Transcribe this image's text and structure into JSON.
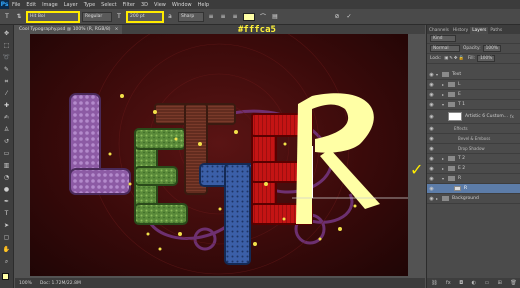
{
  "app": {
    "logo": "Ps"
  },
  "menu": [
    "File",
    "Edit",
    "Image",
    "Layer",
    "Type",
    "Select",
    "Filter",
    "3D",
    "View",
    "Window",
    "Help"
  ],
  "options": {
    "font_family": "Hit Bol",
    "font_style": "Regular",
    "font_size": "200 pt",
    "antialias": "Sharp",
    "text_color": "#ffffa5"
  },
  "annotation": "#fffca5",
  "document": {
    "tab_title": "Cool Typography.psd @ 100% (R, RGB/8)",
    "status_zoom": "100%",
    "status_doc": "Doc: 1.72M/22.8M"
  },
  "artwork": {
    "letters": [
      "L",
      "E",
      "T",
      "T",
      "E",
      "R"
    ],
    "accent_color": "#ffffa5"
  },
  "panel": {
    "tabs": [
      "Channels",
      "History",
      "Layers",
      "Paths"
    ],
    "active_tab": "Layers",
    "search_kind": "Kind",
    "blend_mode": "Normal",
    "opacity_label": "Opacity:",
    "opacity_value": "100%",
    "lock_label": "Lock:",
    "fill_label": "Fill:",
    "fill_value": "100%",
    "layers": [
      {
        "name": "Text",
        "type": "folder",
        "level": 0
      },
      {
        "name": "L",
        "type": "folder",
        "level": 1
      },
      {
        "name": "E",
        "type": "folder",
        "level": 1
      },
      {
        "name": "T 1",
        "type": "folder",
        "level": 1
      },
      {
        "name": "Artistic 6 Custom...",
        "type": "layer",
        "level": 2
      },
      {
        "name": "Effects",
        "type": "fx",
        "level": 2
      },
      {
        "name": "Bevel & Emboss",
        "type": "fx",
        "level": 3
      },
      {
        "name": "Drop Shadow",
        "type": "fx",
        "level": 3
      },
      {
        "name": "T 2",
        "type": "folder",
        "level": 1
      },
      {
        "name": "E 2",
        "type": "folder",
        "level": 1
      },
      {
        "name": "R",
        "type": "folder",
        "level": 1
      },
      {
        "name": "R",
        "type": "text",
        "level": 2
      },
      {
        "name": "Background",
        "type": "folder",
        "level": 0
      }
    ]
  }
}
